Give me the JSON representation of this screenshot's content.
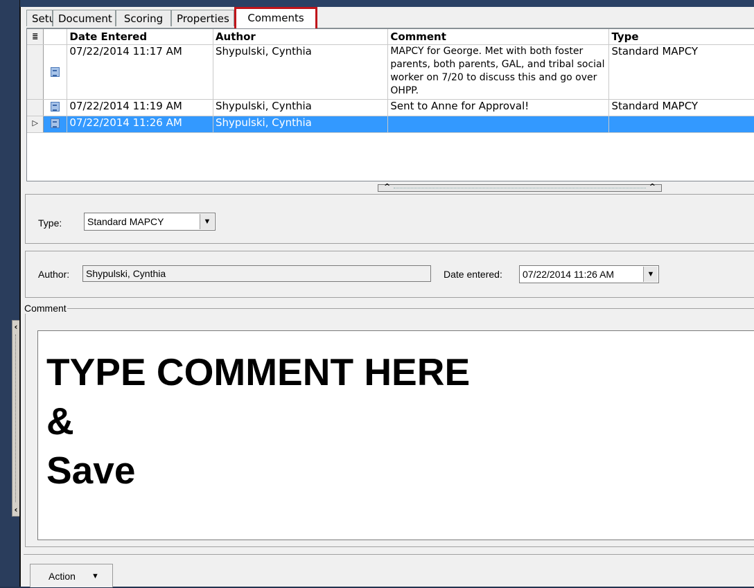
{
  "tabs": [
    "Setup",
    "Document",
    "Scoring",
    "Properties",
    "Comments"
  ],
  "active_tab": "Comments",
  "grid": {
    "columns": [
      "Date Entered",
      "Author",
      "Comment",
      "Type"
    ],
    "rows": [
      {
        "date": "07/22/2014 11:17 AM",
        "author": "Shypulski, Cynthia",
        "comment": "MAPCY for George. Met with both foster parents, both parents, GAL, and tribal social worker  on 7/20 to discuss this and go over OHPP.",
        "type": "Standard MAPCY",
        "selected": false
      },
      {
        "date": "07/22/2014 11:19 AM",
        "author": "Shypulski, Cynthia",
        "comment": "Sent to Anne for Approval!",
        "type": "Standard MAPCY",
        "selected": false
      },
      {
        "date": "07/22/2014 11:26 AM",
        "author": "Shypulski, Cynthia",
        "comment": "",
        "type": "",
        "selected": true
      }
    ]
  },
  "type_section": {
    "label": "Type:",
    "value": "Standard MAPCY"
  },
  "author_section": {
    "label": "Author:",
    "value": "Shypulski, Cynthia",
    "date_label": "Date entered:",
    "date_value": "07/22/2014 11:26 AM"
  },
  "comment_section": {
    "legend": "Comment",
    "text": "TYPE COMMENT HERE\n&\nSave"
  },
  "action": {
    "label": "Action"
  },
  "icons": {
    "row_icon": "document-icon",
    "selected_row": "row-pointer-icon"
  },
  "colors": {
    "selection": "#3399ff",
    "tab_highlight": "#c0151b",
    "background": "#22334f"
  }
}
